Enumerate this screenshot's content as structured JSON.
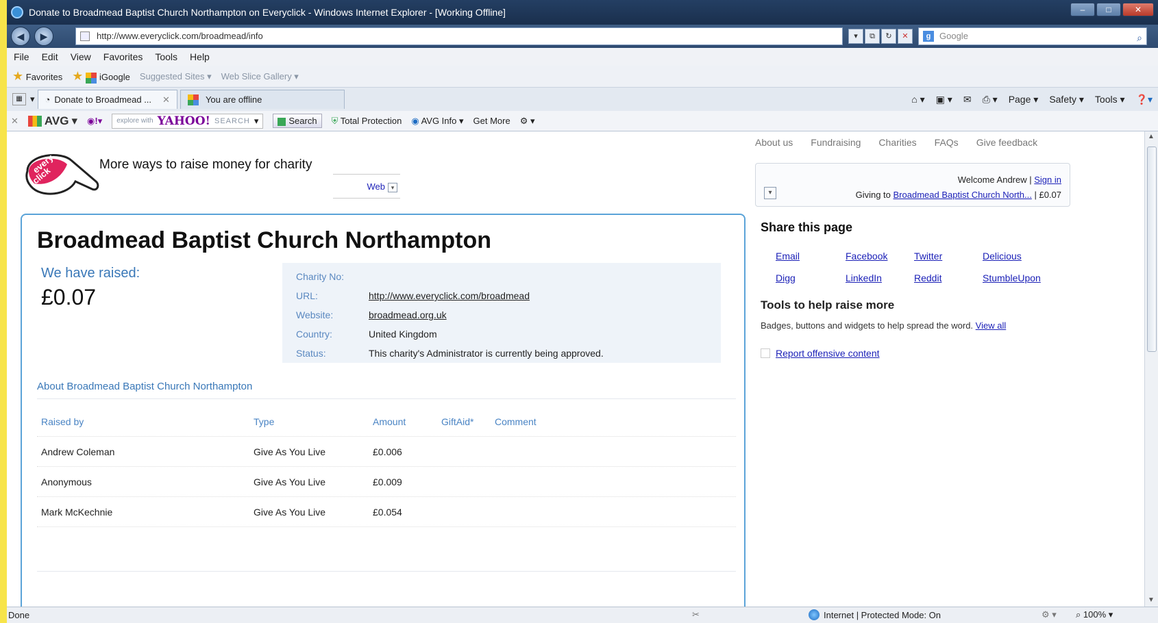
{
  "window": {
    "title": "Donate to Broadmead Baptist Church Northampton on Everyclick - Windows Internet Explorer - [Working Offline]"
  },
  "address": {
    "url": "http://www.everyclick.com/broadmead/info",
    "search_provider": "Google"
  },
  "menu": [
    "File",
    "Edit",
    "View",
    "Favorites",
    "Tools",
    "Help"
  ],
  "favorites": {
    "label": "Favorites",
    "items": [
      "iGoogle",
      "Suggested Sites ▾",
      "Web Slice Gallery ▾"
    ]
  },
  "tabs": {
    "active": "Donate to Broadmead ...",
    "second": "You are offline"
  },
  "tab_tools": [
    "Page ▾",
    "Safety ▾",
    "Tools ▾"
  ],
  "avg_bar": {
    "brand": "AVG",
    "yahoo_hint": "explore with",
    "yahoo_logo": "YAHOO!",
    "yahoo_search": "SEARCH",
    "search_btn": "Search",
    "total_protection": "Total Protection",
    "avg_info": "AVG Info ▾",
    "get_more": "Get More"
  },
  "status": {
    "left": "Done",
    "zone": "Internet | Protected Mode: On",
    "zoom": "100%"
  },
  "page": {
    "tagline": "More ways to raise money for charity",
    "web_dropdown": "Web",
    "topnav": [
      "About us",
      "Fundraising",
      "Charities",
      "FAQs",
      "Give feedback"
    ],
    "welcome": {
      "text": "Welcome Andrew |",
      "sign_in": "Sign in",
      "giving_prefix": "Giving to",
      "giving_link": "Broadmead Baptist Church North...",
      "giving_amount": "| £0.07"
    },
    "title": "Broadmead Baptist Church Northampton",
    "raised_label": "We have raised:",
    "raised_value": "£0.07",
    "details": [
      {
        "key": "Charity No:",
        "value": "",
        "link": false
      },
      {
        "key": "URL:",
        "value": "http://www.everyclick.com/broadmead",
        "link": true
      },
      {
        "key": "Website:",
        "value": "broadmead.org.uk",
        "link": true
      },
      {
        "key": "Country:",
        "value": "United Kingdom",
        "link": false
      },
      {
        "key": "Status:",
        "value": "This charity's Administrator is currently being approved.",
        "link": false
      }
    ],
    "about_title": "About Broadmead Baptist Church Northampton",
    "table": {
      "headers": [
        "Raised by",
        "Type",
        "Amount",
        "GiftAid*",
        "Comment"
      ],
      "rows": [
        [
          "Andrew Coleman",
          "Give As You Live",
          "£0.006"
        ],
        [
          "Anonymous",
          "Give As You Live",
          "£0.009"
        ],
        [
          "Mark McKechnie",
          "Give As You Live",
          "£0.054"
        ]
      ]
    },
    "share": {
      "title": "Share this page",
      "links": [
        "Email",
        "Facebook",
        "Twitter",
        "Delicious",
        "Digg",
        "LinkedIn",
        "Reddit",
        "StumbleUpon"
      ]
    },
    "tools": {
      "title": "Tools to help raise more",
      "text": "Badges, buttons and widgets to help spread the word.",
      "view_all": "View all"
    },
    "report": "Report offensive content"
  }
}
